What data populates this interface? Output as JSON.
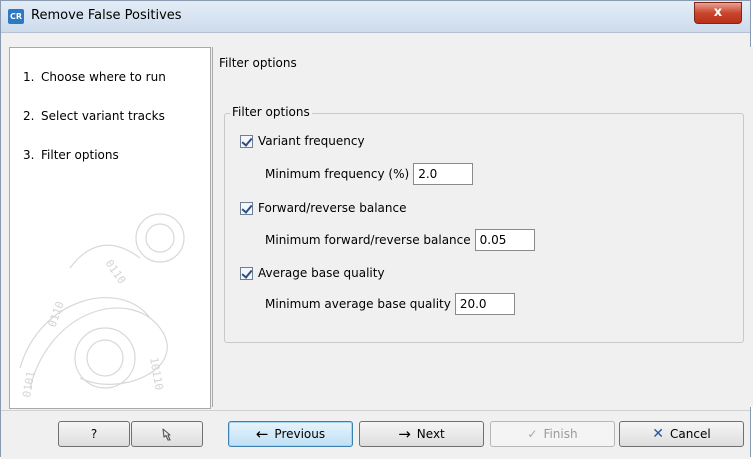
{
  "window": {
    "app_icon": "CR",
    "title": "Remove False Positives",
    "close_glyph": "x"
  },
  "steps": [
    {
      "num": "1.",
      "label": "Choose where to run"
    },
    {
      "num": "2.",
      "label": "Select variant tracks"
    },
    {
      "num": "3.",
      "label": "Filter options"
    }
  ],
  "panel": {
    "title": "Filter options",
    "group_title": "Filter options",
    "filters": [
      {
        "label": "Variant frequency",
        "checked": true,
        "param_label": "Minimum frequency (%)",
        "value": "2.0"
      },
      {
        "label": "Forward/reverse balance",
        "checked": true,
        "param_label": "Minimum forward/reverse balance",
        "value": "0.05"
      },
      {
        "label": "Average base quality",
        "checked": true,
        "param_label": "Minimum average base quality",
        "value": "20.0"
      }
    ]
  },
  "buttons": {
    "help": "?",
    "reset_icon": "reset-arrow-icon",
    "previous": "Previous",
    "next": "Next",
    "finish": "Finish",
    "cancel": "Cancel"
  },
  "colors": {
    "accent": "#2d79c4",
    "close": "#c9462c",
    "cancel_x": "#1d57a6"
  }
}
